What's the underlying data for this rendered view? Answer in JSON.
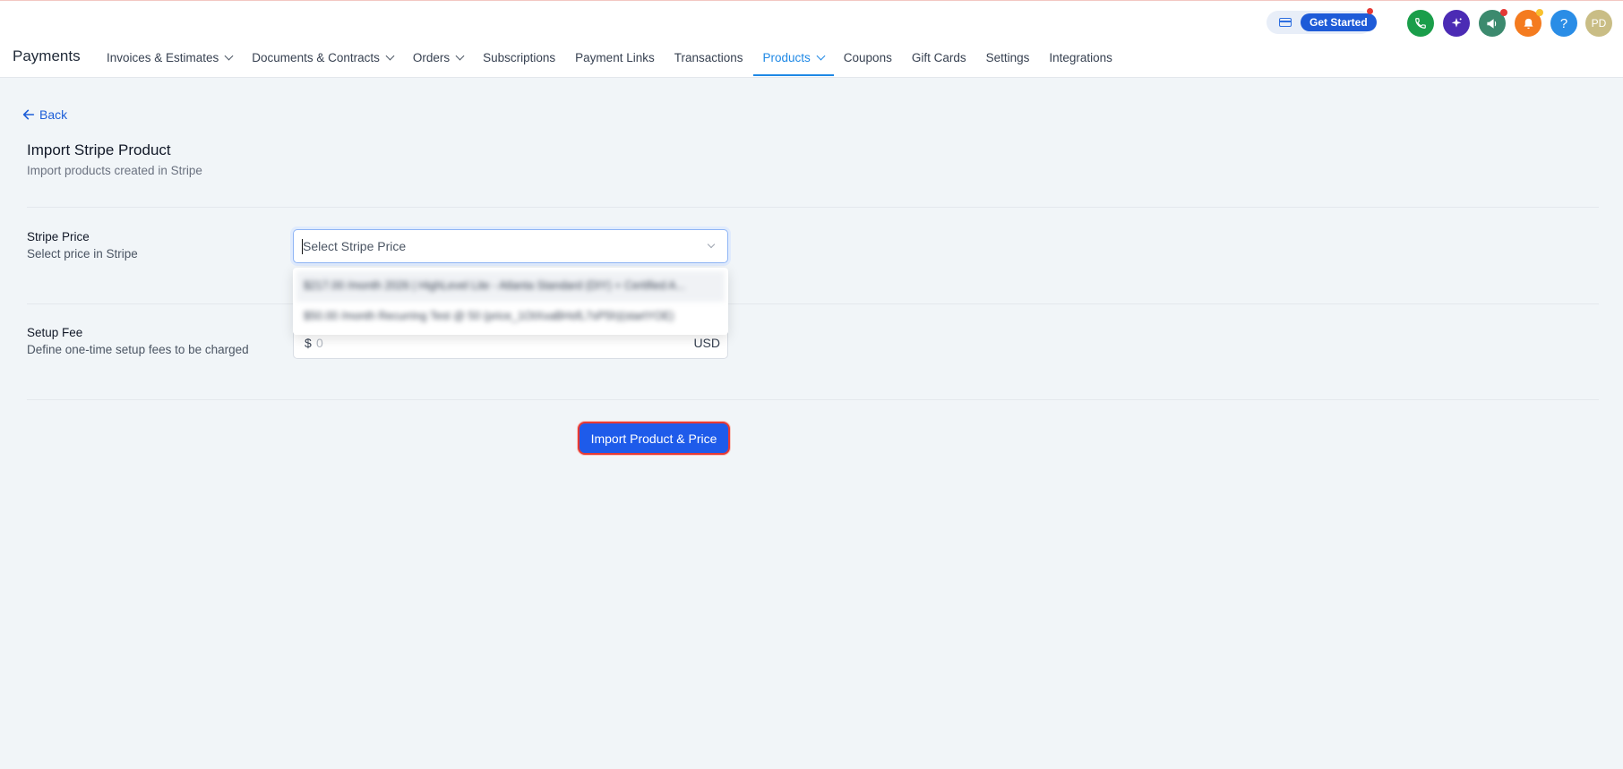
{
  "header": {
    "brand": "Payments",
    "get_started_label": "Get Started",
    "avatar_initials": "PD",
    "help_label": "?",
    "icon_colors": {
      "phone": "#1a9e4a",
      "ai": "#4b2bb4",
      "megaphone": "#3c8a6e",
      "bell": "#f47b1f",
      "help": "#2a8de6",
      "avatar": "#c9bd85"
    }
  },
  "nav": {
    "items": [
      {
        "label": "Invoices & Estimates"
      },
      {
        "label": "Documents & Contracts"
      },
      {
        "label": "Orders"
      },
      {
        "label": "Subscriptions"
      },
      {
        "label": "Payment Links"
      },
      {
        "label": "Transactions"
      },
      {
        "label": "Products"
      },
      {
        "label": "Coupons"
      },
      {
        "label": "Gift Cards"
      },
      {
        "label": "Settings"
      },
      {
        "label": "Integrations"
      }
    ]
  },
  "page": {
    "back_label": "Back",
    "title": "Import Stripe Product",
    "subtitle": "Import products created in Stripe"
  },
  "form": {
    "stripe_price": {
      "label": "Stripe Price",
      "help": "Select price in Stripe",
      "placeholder": "Select Stripe Price",
      "options": [
        "$217.00 /month 2026 | HighLevel Lite - Atlanta Standard (DIY) + Certified A...",
        "$50.00 /month Recurring Test @ 50 (price_1OtXxaBHsfL7sP5h)(startYOE)"
      ]
    },
    "setup_fee": {
      "label": "Setup Fee",
      "help": "Define one-time setup fees to be charged",
      "currency_symbol": "$",
      "placeholder": "0",
      "currency": "USD"
    },
    "submit_label": "Import Product & Price"
  }
}
